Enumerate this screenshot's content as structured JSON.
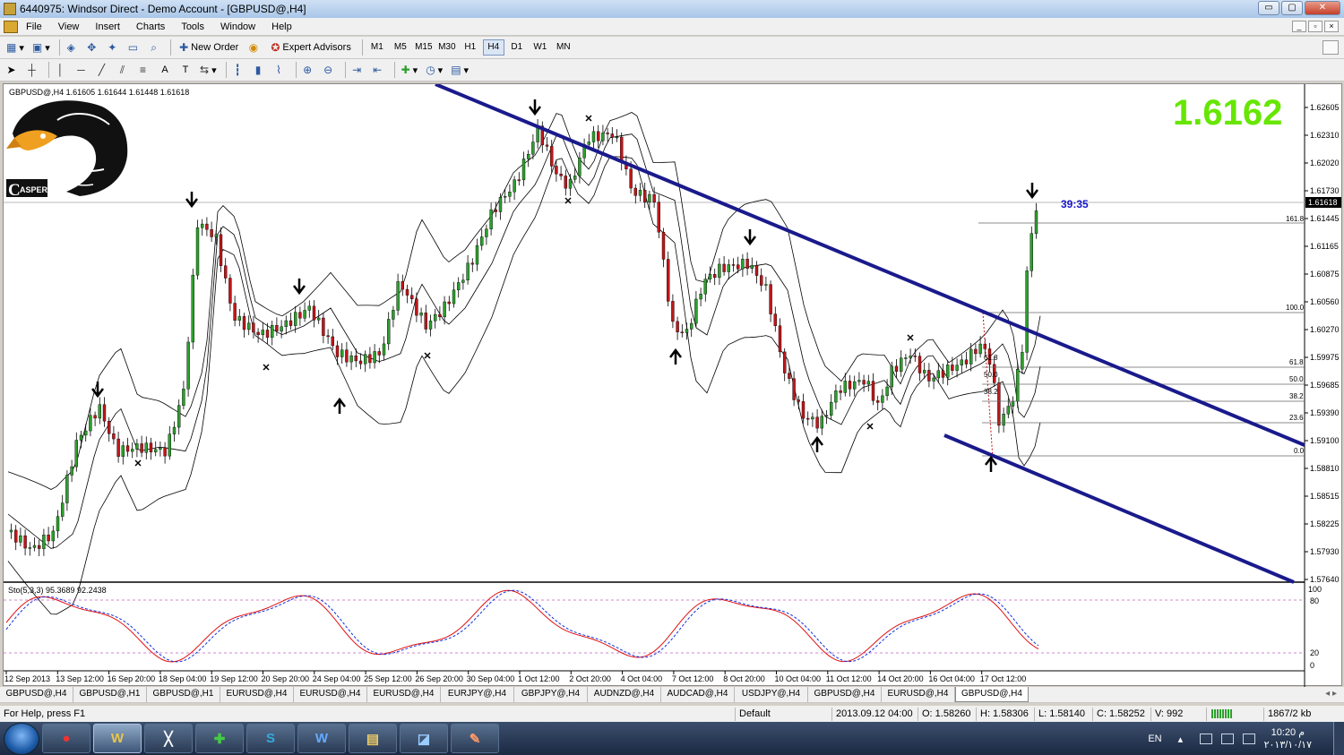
{
  "window": {
    "title": "6440975: Windsor Direct - Demo Account - [GBPUSD@,H4]",
    "min_label": "▭",
    "max_label": "▢",
    "close_label": "✕"
  },
  "menu": [
    "File",
    "View",
    "Insert",
    "Charts",
    "Tools",
    "Window",
    "Help"
  ],
  "mdi": {
    "min": "_",
    "restore": "▫",
    "close": "×"
  },
  "toolbar": {
    "new_order": "New Order",
    "expert_advisors": "Expert Advisors",
    "timeframes": [
      "M1",
      "M5",
      "M15",
      "M30",
      "H1",
      "H4",
      "D1",
      "W1",
      "MN"
    ],
    "active_timeframe": "H4",
    "text_tool": "A",
    "textlabel_tool": "T"
  },
  "chart": {
    "symbol_line": "GBPUSD@,H4  1.61605 1.61644 1.61448 1.61618",
    "big_price": "1.6162",
    "countdown": "39:35",
    "logo_letter": "C",
    "logo_text": "ASPER",
    "price_labels": [
      "1.62605",
      "1.62310",
      "1.62020",
      "1.61730",
      "1.61445",
      "1.61165",
      "1.60875",
      "1.60560",
      "1.60270",
      "1.59975",
      "1.59685",
      "1.59390",
      "1.59100",
      "1.58810",
      "1.58515",
      "1.58225",
      "1.57930",
      "1.57640"
    ],
    "current_price_tag": "1.61618",
    "fib_right": [
      "161.8",
      "100.0",
      "61.8",
      "50.0",
      "38.2",
      "23.6",
      "0.0"
    ],
    "fib_left": [
      "61.8",
      "50.0",
      "38.2"
    ],
    "stoch_label": "Sto(5,3,3) 95.3689 92.2438",
    "stoch_levels": [
      "100",
      "80",
      "20",
      "0"
    ],
    "time_labels": [
      "12 Sep 2013",
      "13 Sep 12:00",
      "16 Sep 20:00",
      "18 Sep 04:00",
      "19 Sep 12:00",
      "20 Sep 20:00",
      "24 Sep 04:00",
      "25 Sep 12:00",
      "26 Sep 20:00",
      "30 Sep 04:00",
      "1 Oct 12:00",
      "2 Oct 20:00",
      "4 Oct 04:00",
      "7 Oct 12:00",
      "8 Oct 20:00",
      "10 Oct 04:00",
      "11 Oct 12:00",
      "14 Oct 20:00",
      "16 Oct 04:00",
      "17 Oct 12:00"
    ],
    "colors": {
      "bull": "#2ca02c",
      "bear": "#c0161a",
      "trend": "#1a1a8c",
      "big_price": "#66e600",
      "countdown": "#1515d0",
      "stoch_main": "#e01010",
      "stoch_signal": "#1030e0"
    }
  },
  "tabs": [
    "GBPUSD@,H4",
    "GBPUSD@,H1",
    "GBPUSD@,H1",
    "EURUSD@,H4",
    "EURUSD@,H4",
    "EURUSD@,H4",
    "EURJPY@,H4",
    "GBPJPY@,H4",
    "AUDNZD@,H4",
    "AUDCAD@,H4",
    "USDJPY@,H4",
    "GBPUSD@,H4",
    "EURUSD@,H4",
    "GBPUSD@,H4"
  ],
  "active_tab": 13,
  "tab_nav": "◂ ▸",
  "status": {
    "help": "For Help, press F1",
    "profile": "Default",
    "datetime": "2013.09.12 04:00",
    "open": "O: 1.58260",
    "high": "H: 1.58306",
    "low": "L: 1.58140",
    "close": "C: 1.58252",
    "volume": "V: 992",
    "traffic": "1867/2 kb"
  },
  "taskbar": {
    "apps": [
      "chrome",
      "metatrader",
      "vector",
      "trader-tool",
      "skype",
      "word",
      "explorer",
      "notepad",
      "paint"
    ],
    "app_glyphs": [
      "●",
      "W",
      "╳",
      "✚",
      "S",
      "W",
      "▤",
      "◪",
      "✎"
    ],
    "lang": "EN",
    "time": "10:20 م",
    "date": "٢٠١٣/١٠/١٧"
  }
}
